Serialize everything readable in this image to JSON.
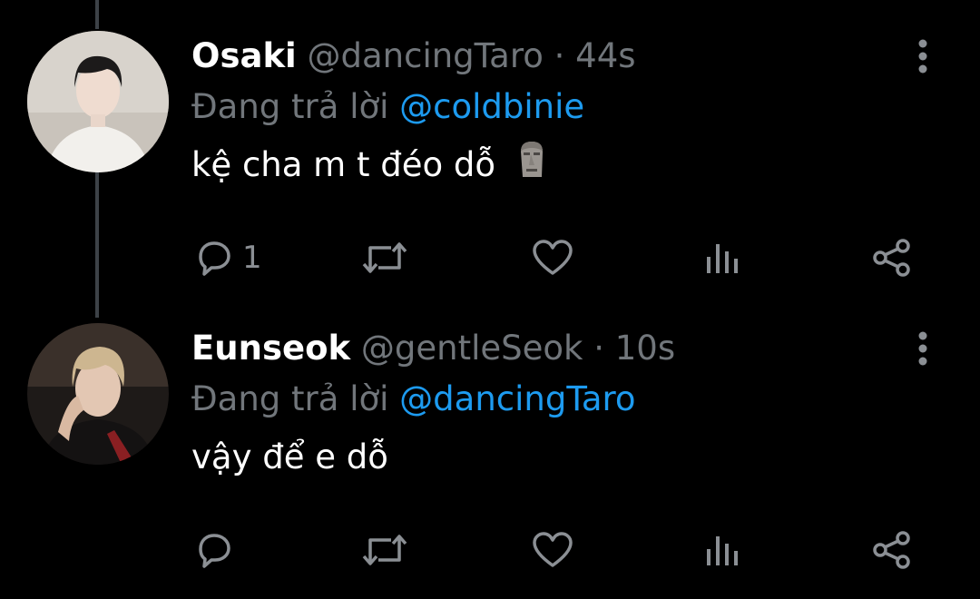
{
  "tweets": [
    {
      "name": "Osaki",
      "handle": "@dancingTaro",
      "separator": "·",
      "time": "44s",
      "reply_prefix": "Đang trả lời",
      "reply_to": "@coldbinie",
      "text": "kệ cha m t đéo dỗ",
      "emoji": "moai",
      "reply_count": "1"
    },
    {
      "name": "Eunseok",
      "handle": "@gentleSeok",
      "separator": "·",
      "time": "10s",
      "reply_prefix": "Đang trả lời",
      "reply_to": "@dancingTaro",
      "text": "vậy để e dỗ",
      "reply_count": ""
    }
  ],
  "icons": [
    "reply-icon",
    "retweet-icon",
    "like-icon",
    "analytics-icon",
    "share-icon",
    "more-icon"
  ],
  "colors": {
    "background": "#000000",
    "text_primary": "#ffffff",
    "text_secondary": "#71767b",
    "link": "#1d9bf0",
    "icon": "#8b8f94",
    "thread_line": "#3d4247"
  }
}
